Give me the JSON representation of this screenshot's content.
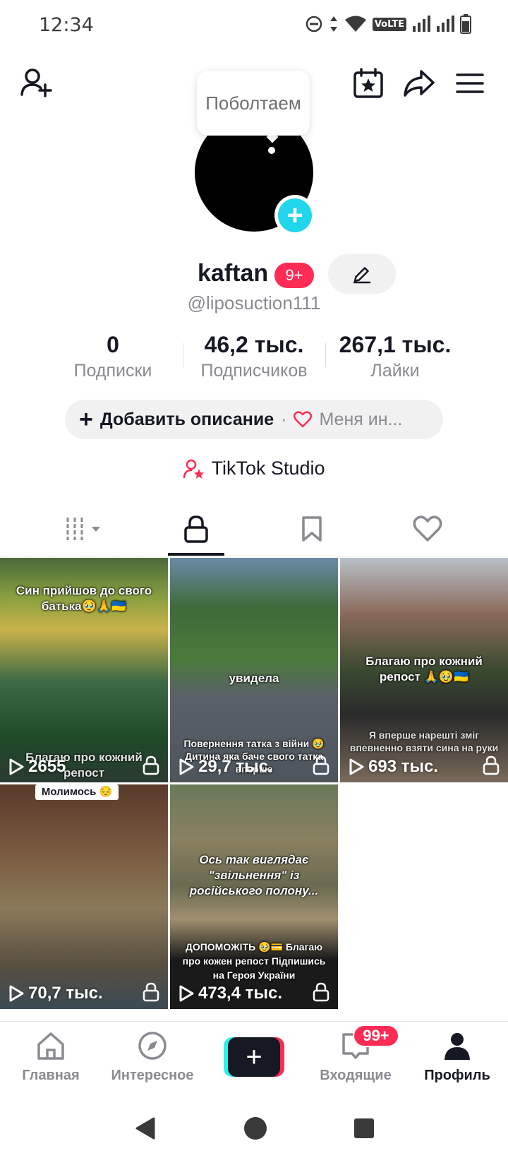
{
  "status_bar": {
    "time": "12:34",
    "network_label": "VoLTE"
  },
  "bubble": {
    "text": "Поболтаем"
  },
  "profile": {
    "username": "kaftan",
    "notif_badge": "9+",
    "handle": "@liposuction111"
  },
  "stats": [
    {
      "value": "0",
      "label": "Подписки"
    },
    {
      "value": "46,2 тыс.",
      "label": "Подписчиков"
    },
    {
      "value": "267,1 тыс.",
      "label": "Лайки"
    }
  ],
  "description": {
    "add_label": "Добавить описание",
    "separator": "·",
    "bio_preview": "Меня ин..."
  },
  "studio": {
    "label": "TikTok Studio"
  },
  "tabs": [
    {
      "name": "grid",
      "icon": "grid-icon"
    },
    {
      "name": "private",
      "icon": "lock-icon",
      "active": true
    },
    {
      "name": "saved",
      "icon": "bookmark-icon"
    },
    {
      "name": "liked",
      "icon": "heart-icon"
    }
  ],
  "videos": [
    {
      "views": "2655",
      "caption_top": "Син прийшов до свого батька🥹🙏🇺🇦",
      "caption_bottom": "Благаю про кожний репост",
      "locked": true
    },
    {
      "views": "29,7 тыс.",
      "caption_top": "увидела",
      "caption_bottom": "Повернення татка з війни 🥹 Дитина яка баче свого татка вперше",
      "locked": true
    },
    {
      "views": "693 тыс.",
      "caption_top": "Благаю про кожний репост 🙏🥹🇺🇦",
      "caption_bottom": "Я вперше нарешті зміг впевненно взяти сина на руки",
      "locked": true
    },
    {
      "views": "70,7 тыс.",
      "caption_top": "Молимось 😔",
      "caption_bottom": "",
      "locked": true
    },
    {
      "views": "473,4 тыс.",
      "caption_top": "Ось так виглядає \"звільнення\" із російського полону...",
      "caption_bottom": "ДОПОМОЖІТЬ 🥹💳 Благаю про кожен репост Підпишись на Героя України",
      "locked": true
    }
  ],
  "bottom_nav": {
    "home": "Главная",
    "discover": "Интересное",
    "create": "+",
    "inbox": "Входящие",
    "inbox_badge": "99+",
    "profile": "Профиль"
  },
  "colors": {
    "accent": "#fe2c55",
    "cyan": "#25f4ee",
    "add_blue": "#20d5ec"
  }
}
